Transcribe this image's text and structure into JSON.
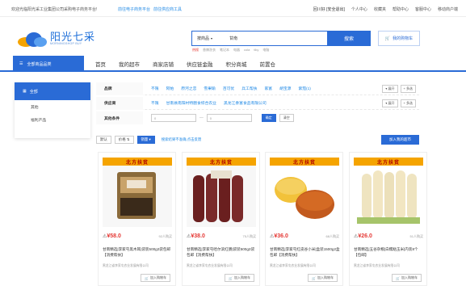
{
  "topbar": {
    "welcome": "欢迎光临阳光采工业集团公司采购电子商务平台!",
    "login_link": "前往电子商务平台",
    "supply_link": "前往供应商工具",
    "user": "回川好 [安全退出]",
    "links": [
      "个人中心",
      "收藏夹",
      "帮助中心",
      "客服中心",
      "移动商户端"
    ]
  },
  "header": {
    "logo_title": "阳光七采",
    "logo_sub": "MORNINGSHOP BUY",
    "search_category": "按商品",
    "search_value": "甘南",
    "search_button": "搜索",
    "hot_label": "热搜",
    "hot_terms": [
      "香辣洗衣",
      "笔记本",
      "电器",
      "cola",
      "tiky",
      "电脑"
    ],
    "cart_label": "我的购物车"
  },
  "nav": {
    "all_categories": "全部商品品类",
    "items": [
      "首页",
      "我的超市",
      "商家店铺",
      "供应链金融",
      "积分商城",
      "前置仓"
    ]
  },
  "sidebar": {
    "head": "全部",
    "items": [
      "其他",
      "福利产品"
    ]
  },
  "filter": {
    "brand_label": "品牌",
    "brand_options": [
      "不限",
      "阿帕",
      "原河之恋",
      "雪果瑜",
      "百可优",
      "兵工帮扶",
      "家富",
      "胡宝源",
      "紫茄(1)"
    ],
    "supplier_label": "供应商",
    "supplier_options": [
      "不限",
      "甘南县南阳村特膳食综合农业",
      "黑龙江黍富食品有限公司"
    ],
    "price_label": "其他条件",
    "price_from_placeholder": "0",
    "price_to_placeholder": "0",
    "ok_button": "确定",
    "clear_button": "清空",
    "expand_button": "展开",
    "multi_button": "多选"
  },
  "sortbar": {
    "default": "默认",
    "price": "价格",
    "sales": "销量",
    "tip": "搜索结果不准确,点击反馈",
    "add_all": "加入我的超市"
  },
  "products": [
    {
      "banner": "北方扶贫",
      "price": "¥58.0",
      "sold": "92人购买",
      "name": "甘南精选|李家屯黑木耳|袋装500g2袋包邮【消费帮扶】",
      "shop": "黑龙江省李家屯农业发展有限公司",
      "add_cart": "加入购物车",
      "image_color": "#8a6a3a"
    },
    {
      "banner": "北方扶贫",
      "price": "¥38.0",
      "sold": "75人购买",
      "name": "甘南精选|李家屯哈尔滨红肠|袋装500g2袋包邮【消费帮扶】",
      "shop": "黑龙江省李家屯农业发展有限公司",
      "add_cart": "加入购物车",
      "image_color": "#7a2a2a"
    },
    {
      "banner": "北方扶贫",
      "price": "¥36.0",
      "sold": "68人购买",
      "name": "甘南精选|李家屯红皮谷小米|盒装1500g2盒包邮【消费帮扶】",
      "shop": "黑龙江省李家屯农业发展有限公司",
      "add_cart": "加入购物车",
      "image_color": "#e0a020"
    },
    {
      "banner": "北方扶贫",
      "price": "¥26.0",
      "sold": "51人购买",
      "name": "甘南精选|五谷杂粮|白糯粘玉米|内装8个【包邮】",
      "shop": "黑龙江省李家屯农业发展有限公司",
      "add_cart": "加入购物车",
      "image_color": "#f2e6c2"
    }
  ]
}
